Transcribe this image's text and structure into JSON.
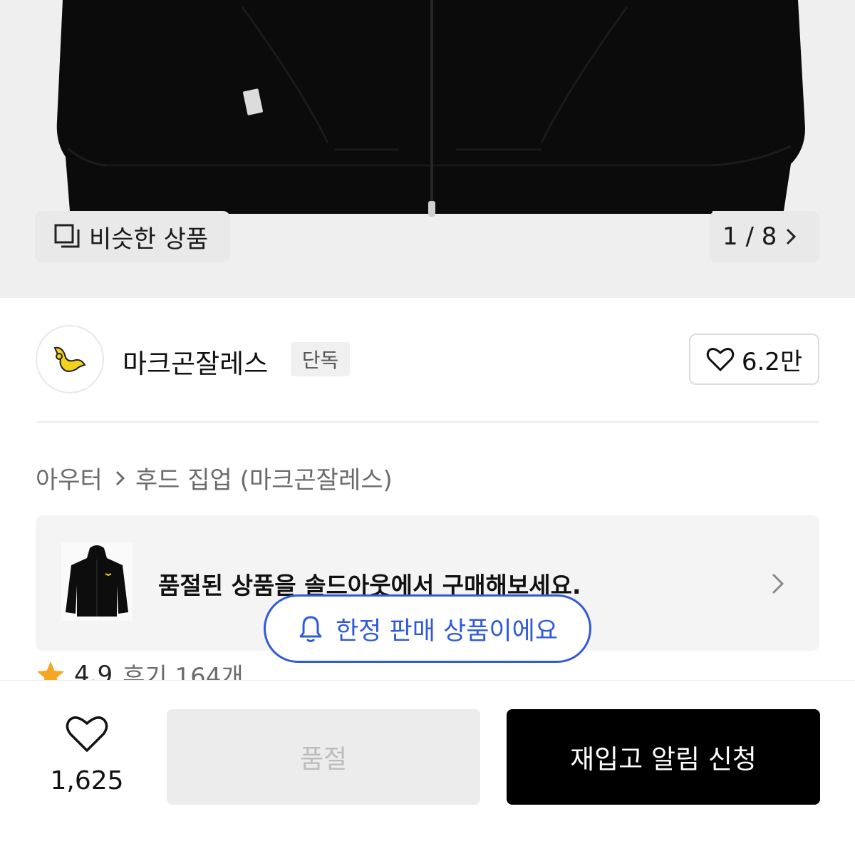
{
  "hero": {
    "similar_label": "비슷한 상품",
    "page_indicator": "1 / 8",
    "icons": {
      "similar": "similar-products-icon",
      "next": "chevron-right-icon"
    }
  },
  "brand": {
    "name": "마크곤잘레스",
    "badge": "단독",
    "like_count": "6.2만",
    "logo_icon": "angel-logo-icon",
    "logo_color": "#f2d21c"
  },
  "breadcrumb": {
    "items": [
      "아우터",
      "후드 집업 (마크곤잘레스)"
    ]
  },
  "soldout_banner": {
    "text": "품절된 상품을 솔드아웃에서 구매해보세요."
  },
  "rating": {
    "score": "4.9",
    "reviews": "후기 164개",
    "star_color": "#f5a623"
  },
  "limited": {
    "label": "한정 판매 상품이에요",
    "accent_color": "#2f5bd6",
    "icon": "bell-icon"
  },
  "bottom_bar": {
    "wish_count": "1,625",
    "soldout_label": "품절",
    "restock_label": "재입고 알림 신청"
  }
}
